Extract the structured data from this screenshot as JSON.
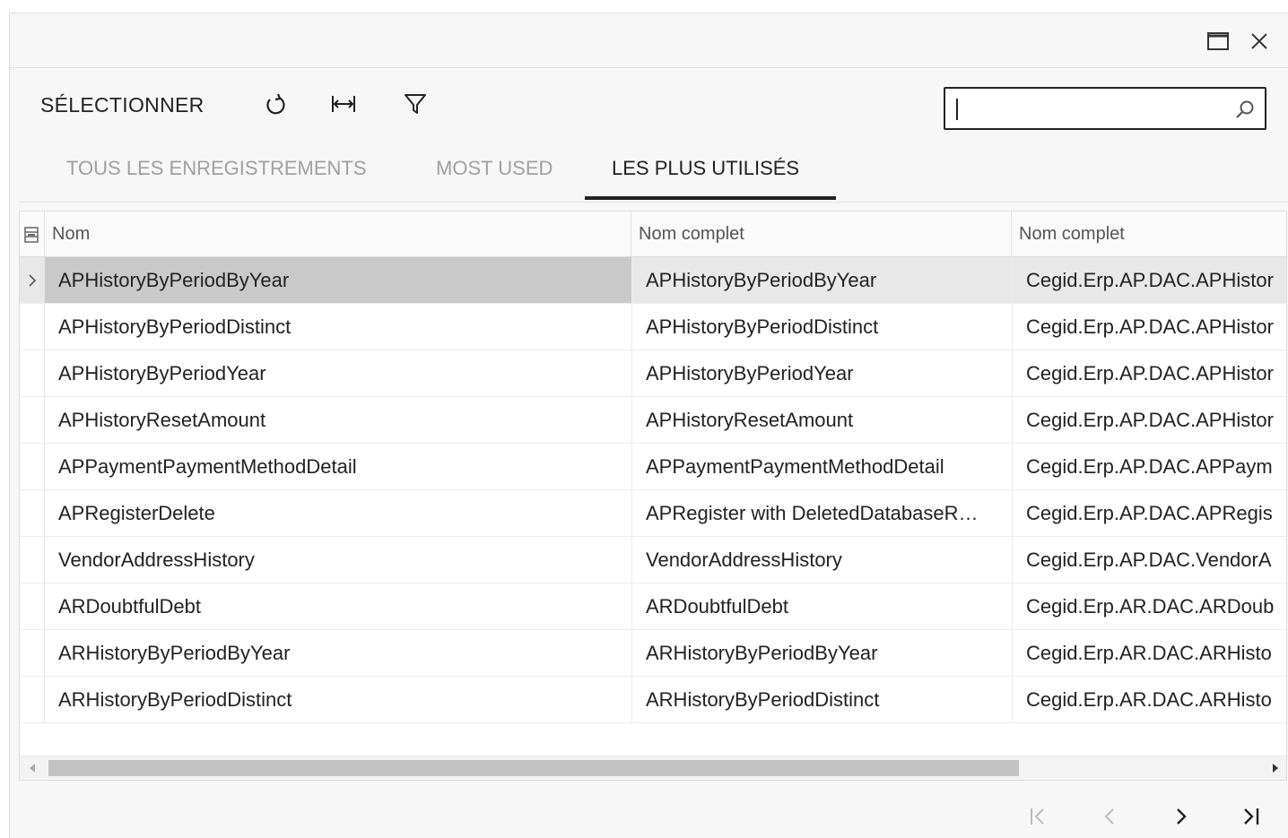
{
  "toolbar": {
    "select_label": "SÉLECTIONNER",
    "icons": [
      "refresh-icon",
      "fit-columns-icon",
      "filter-icon"
    ],
    "search_value": ""
  },
  "window": {
    "icons": [
      "maximize-icon",
      "close-icon"
    ]
  },
  "tabs": [
    {
      "label": "TOUS LES ENREGISTREMENTS",
      "active": false
    },
    {
      "label": "MOST USED",
      "active": false
    },
    {
      "label": "LES PLUS UTILISÉS",
      "active": true
    }
  ],
  "grid": {
    "headers": [
      "Nom",
      "Nom complet",
      "Nom complet"
    ],
    "rows": [
      {
        "c1": "APHistoryByPeriodByYear",
        "c2": "APHistoryByPeriodByYear",
        "c3": "Cegid.Erp.AP.DAC.APHistor",
        "selected": true
      },
      {
        "c1": "APHistoryByPeriodDistinct",
        "c2": "APHistoryByPeriodDistinct",
        "c3": "Cegid.Erp.AP.DAC.APHistor"
      },
      {
        "c1": "APHistoryByPeriodYear",
        "c2": "APHistoryByPeriodYear",
        "c3": "Cegid.Erp.AP.DAC.APHistor"
      },
      {
        "c1": "APHistoryResetAmount",
        "c2": "APHistoryResetAmount",
        "c3": "Cegid.Erp.AP.DAC.APHistor"
      },
      {
        "c1": "APPaymentPaymentMethodDetail",
        "c2": "APPaymentPaymentMethodDetail",
        "c3": "Cegid.Erp.AP.DAC.APPaym"
      },
      {
        "c1": "APRegisterDelete",
        "c2": "APRegister with DeletedDatabaseR…",
        "c3": "Cegid.Erp.AP.DAC.APRegis"
      },
      {
        "c1": "VendorAddressHistory",
        "c2": "VendorAddressHistory",
        "c3": "Cegid.Erp.AP.DAC.VendorA"
      },
      {
        "c1": "ARDoubtfulDebt",
        "c2": "ARDoubtfulDebt",
        "c3": "Cegid.Erp.AR.DAC.ARDoub"
      },
      {
        "c1": "ARHistoryByPeriodByYear",
        "c2": "ARHistoryByPeriodByYear",
        "c3": "Cegid.Erp.AR.DAC.ARHisto"
      },
      {
        "c1": "ARHistoryByPeriodDistinct",
        "c2": "ARHistoryByPeriodDistinct",
        "c3": "Cegid.Erp.AR.DAC.ARHisto"
      }
    ]
  },
  "pager": {
    "icons": [
      "first-page-icon",
      "prev-page-icon",
      "next-page-icon",
      "last-page-icon"
    ]
  }
}
